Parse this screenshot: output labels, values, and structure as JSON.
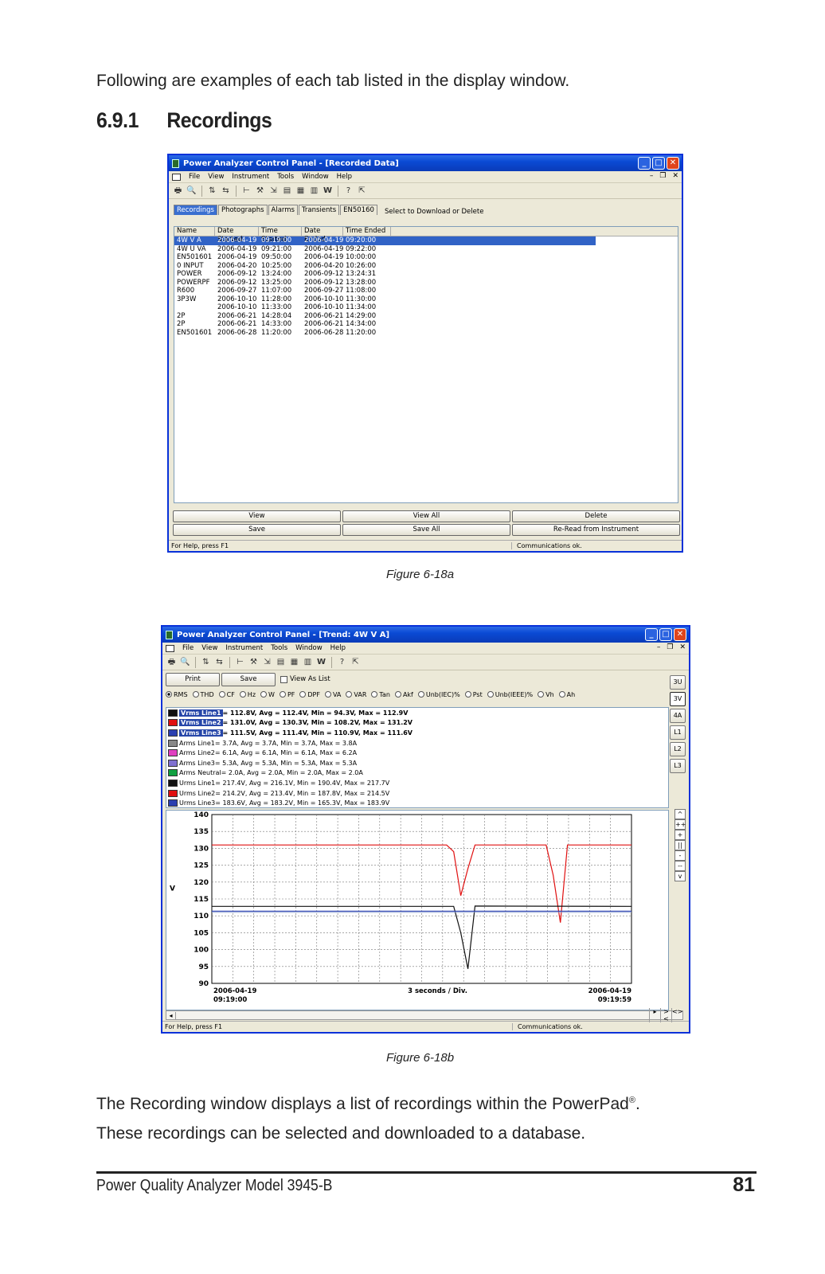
{
  "intro": "Following are examples of each tab listed in the display window.",
  "section": {
    "number": "6.9.1",
    "title": "Recordings"
  },
  "window1": {
    "title": "Power Analyzer Control Panel - [Recorded Data]",
    "menu": [
      "File",
      "View",
      "Instrument",
      "Tools",
      "Window",
      "Help"
    ],
    "tabs": [
      "Recordings",
      "Photographs",
      "Alarms",
      "Transients",
      "EN50160"
    ],
    "list_caption": "Select to Download or Delete",
    "columns": [
      "Name",
      "Date Started",
      "Time Started",
      "Date Ended",
      "Time Ended"
    ],
    "rows": [
      [
        "4W V A",
        "2006-04-19",
        "09:19:00",
        "2006-04-19",
        "09:20:00"
      ],
      [
        "4W U VA",
        "2006-04-19",
        "09:21:00",
        "2006-04-19",
        "09:22:00"
      ],
      [
        "EN501601",
        "2006-04-19",
        "09:50:00",
        "2006-04-19",
        "10:00:00"
      ],
      [
        "0 INPUT",
        "2006-04-20",
        "10:25:00",
        "2006-04-20",
        "10:26:00"
      ],
      [
        "POWER",
        "2006-09-12",
        "13:24:00",
        "2006-09-12",
        "13:24:31"
      ],
      [
        "POWERPF",
        "2006-09-12",
        "13:25:00",
        "2006-09-12",
        "13:28:00"
      ],
      [
        "R600",
        "2006-09-27",
        "11:07:00",
        "2006-09-27",
        "11:08:00"
      ],
      [
        "3P3W",
        "2006-10-10",
        "11:28:00",
        "2006-10-10",
        "11:30:00"
      ],
      [
        "",
        "2006-10-10",
        "11:33:00",
        "2006-10-10",
        "11:34:00"
      ],
      [
        "2P",
        "2006-06-21",
        "14:28:04",
        "2006-06-21",
        "14:29:00"
      ],
      [
        "2P",
        "2006-06-21",
        "14:33:00",
        "2006-06-21",
        "14:34:00"
      ],
      [
        "EN501601",
        "2006-06-28",
        "11:20:00",
        "2006-06-28",
        "11:20:00"
      ]
    ],
    "buttons": [
      "View",
      "View All",
      "Delete",
      "Save",
      "Save All",
      "Re-Read from Instrument"
    ],
    "status_left": "For Help, press F1",
    "status_right": "Communications ok."
  },
  "caption_a": "Figure 6-18a",
  "window2": {
    "title": "Power Analyzer Control Panel - [Trend: 4W V A]",
    "menu": [
      "File",
      "View",
      "Instrument",
      "Tools",
      "Window",
      "Help"
    ],
    "print_label": "Print",
    "save_label": "Save",
    "view_as_list": "View As List",
    "radios": [
      "RMS",
      "THD",
      "CF",
      "Hz",
      "W",
      "PF",
      "DPF",
      "VA",
      "VAR",
      "Tan",
      "Akf",
      "Unb(IEC)%",
      "Pst",
      "Unb(IEEE)%",
      "Vh",
      "Ah"
    ],
    "side_buttons": [
      "3U",
      "3V",
      "4A",
      "L1",
      "L2",
      "L3"
    ],
    "zoom_buttons": [
      "^",
      "++",
      "+",
      "||",
      "-",
      "--",
      "v"
    ],
    "legend": [
      {
        "label": "Vrms Line1",
        "text": " = 112.8V, Avg = 112.4V, Min = 94.3V, Max = 112.9V",
        "color": "#111111",
        "bold": true
      },
      {
        "label": "Vrms Line2",
        "text": " = 131.0V, Avg = 130.3V, Min = 108.2V, Max = 131.2V",
        "color": "#e01010",
        "bold": true
      },
      {
        "label": "Vrms Line3",
        "text": " = 111.5V, Avg = 111.4V, Min = 110.9V, Max = 111.6V",
        "color": "#2a3fb0",
        "bold": true
      },
      {
        "label": "Arms Line1",
        "text": " = 3.7A, Avg = 3.7A, Min = 3.7A, Max = 3.8A",
        "color": "#888888",
        "bold": false
      },
      {
        "label": "Arms Line2",
        "text": " = 6.1A, Avg = 6.1A, Min = 6.1A, Max = 6.2A",
        "color": "#e040c0",
        "bold": false
      },
      {
        "label": "Arms Line3",
        "text": " = 5.3A, Avg = 5.3A, Min = 5.3A, Max = 5.3A",
        "color": "#8070d0",
        "bold": false
      },
      {
        "label": "Arms Neutral",
        "text": " = 2.0A, Avg = 2.0A, Min = 2.0A, Max = 2.0A",
        "color": "#10a040",
        "bold": false
      },
      {
        "label": "Urms Line1",
        "text": " = 217.4V, Avg = 216.1V, Min = 190.4V, Max = 217.7V",
        "color": "#111111",
        "bold": false
      },
      {
        "label": "Urms Line2",
        "text": " = 214.2V, Avg = 213.4V, Min = 187.8V, Max = 214.5V",
        "color": "#e01010",
        "bold": false
      },
      {
        "label": "Urms Line3",
        "text": " = 183.6V, Avg = 183.2V, Min = 165.3V, Max = 183.9V",
        "color": "#2a3fb0",
        "bold": false
      }
    ],
    "x_left": [
      "2006-04-19",
      "09:19:00"
    ],
    "x_center": "3 seconds / Div.",
    "x_right": [
      "2006-04-19",
      "09:19:59"
    ],
    "status_left": "For Help, press F1",
    "status_right": "Communications ok."
  },
  "chart_data": {
    "type": "line",
    "ylabel": "V",
    "ylim": [
      90,
      140
    ],
    "yticks": [
      140,
      135,
      130,
      125,
      120,
      115,
      110,
      105,
      100,
      95,
      90
    ],
    "xlim": [
      0,
      59
    ],
    "grid": true,
    "series": [
      {
        "name": "Vrms Line2",
        "color": "#e01010",
        "x": [
          0,
          33,
          34,
          35,
          36,
          37,
          47,
          48,
          49,
          50,
          59
        ],
        "y": [
          131,
          131,
          129,
          116,
          124,
          131,
          131,
          122,
          108,
          131,
          131
        ]
      },
      {
        "name": "Vrms Line1",
        "color": "#111111",
        "x": [
          0,
          34,
          35,
          36,
          37,
          59
        ],
        "y": [
          112.8,
          112.8,
          105,
          94.3,
          112.9,
          112.8
        ]
      },
      {
        "name": "Vrms Line3",
        "color": "#2a3fb0",
        "x": [
          0,
          59
        ],
        "y": [
          111.4,
          111.4
        ]
      }
    ]
  },
  "caption_b": "Figure 6-18b",
  "body": {
    "line1": "The Recording window displays a list of recordings within the PowerPad",
    "reg": "®",
    "line1_end": ".",
    "line2": "These recordings can be selected and downloaded to a database."
  },
  "footer": {
    "left": "Power Quality Analyzer Model 3945-B",
    "page": "81"
  }
}
